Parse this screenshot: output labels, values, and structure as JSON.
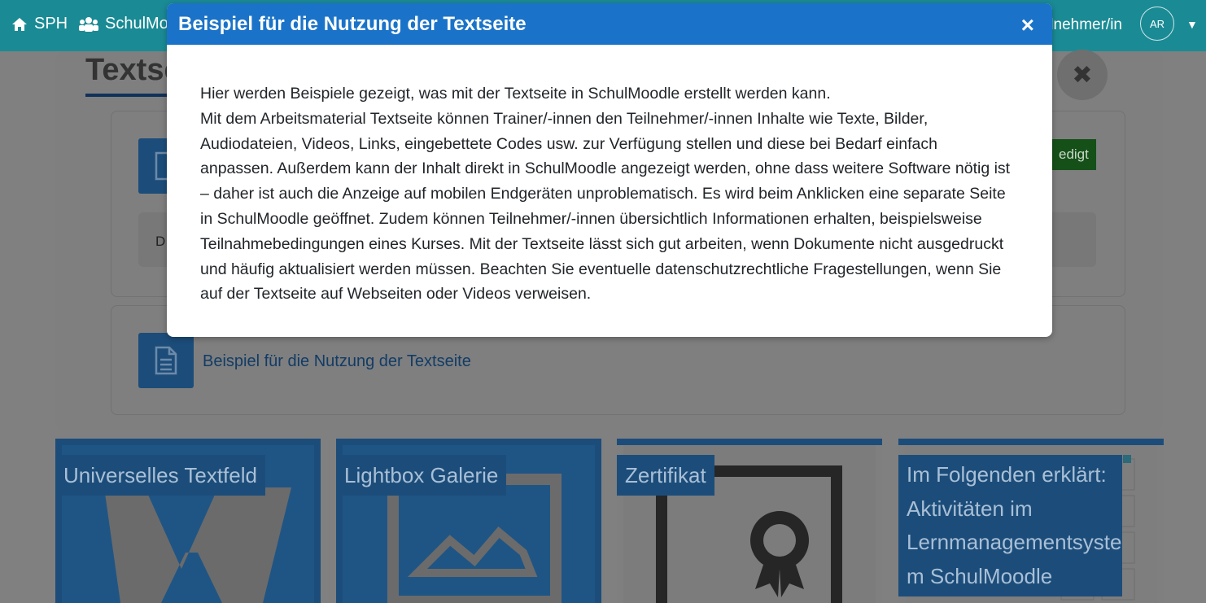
{
  "navbar": {
    "home_label": "SPH",
    "course_label": "SchulMo",
    "role_label": "lnehmer/in",
    "avatar_initials": "AR",
    "icons": [
      "home-icon",
      "users-icon",
      "chevron-down-icon"
    ]
  },
  "background": {
    "page_title": "Textse",
    "done_label": "edigt",
    "description_initial": "D",
    "link_label": "Beispiel für die Nutzung der Textseite",
    "tiles": [
      {
        "label": "Universelles Textfeld"
      },
      {
        "label": "Lightbox Galerie"
      },
      {
        "label": "Zertifikat"
      },
      {
        "label": "Im Folgenden erklärt: Aktivitäten im Lernmanagementsyste m SchulMoodle"
      }
    ]
  },
  "modal": {
    "title": "Beispiel für die Nutzung der Textseite",
    "close_symbol": "×",
    "paragraph1": "Hier werden Beispiele gezeigt, was mit der Textseite in SchulMoodle erstellt werden kann.",
    "paragraph2": "Mit dem Arbeitsmaterial Textseite können Trainer/-innen den Teilnehmer/-innen Inhalte wie Texte, Bilder, Audiodateien, Videos, Links, eingebettete Codes usw. zur Verfügung stellen und diese bei Bedarf einfach anpassen. Außerdem kann der Inhalt direkt in SchulMoodle angezeigt werden, ohne dass weitere Software nötig ist – daher ist auch die Anzeige auf mobilen Endgeräten unproblematisch. Es wird beim Anklicken eine separate Seite in SchulMoodle geöffnet. Zudem können Teilnehmer/-innen übersichtlich Informationen erhalten, beispielsweise Teilnahmebedingungen eines Kurses. Mit der Textseite lässt sich gut arbeiten, wenn Dokumente nicht ausgedruckt und häufig aktualisiert werden müssen. Beachten Sie eventuelle datenschutzrechtliche Fragestellungen, wenn Sie auf der Textseite auf Webseiten oder Videos verweisen."
  },
  "colors": {
    "navbar": "#1a8b95",
    "modal_header": "#1a73c8",
    "overlay": "#808080"
  }
}
